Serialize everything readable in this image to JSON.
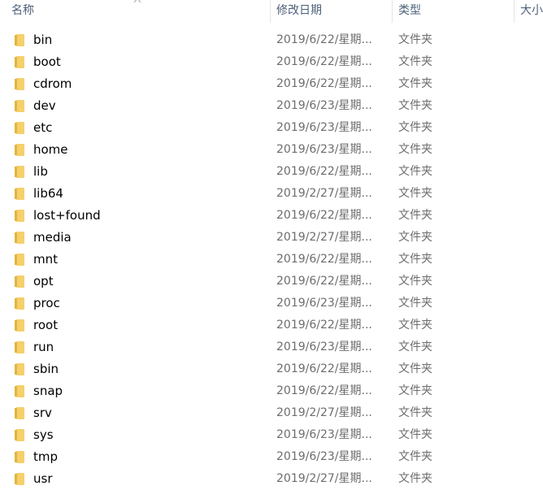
{
  "header": {
    "name_label": "名称",
    "date_label": "修改日期",
    "type_label": "类型",
    "size_label": "大小"
  },
  "rows": [
    {
      "name": "bin",
      "date": "2019/6/22/星期...",
      "type": "文件夹"
    },
    {
      "name": "boot",
      "date": "2019/6/22/星期...",
      "type": "文件夹"
    },
    {
      "name": "cdrom",
      "date": "2019/6/22/星期...",
      "type": "文件夹"
    },
    {
      "name": "dev",
      "date": "2019/6/23/星期...",
      "type": "文件夹"
    },
    {
      "name": "etc",
      "date": "2019/6/23/星期...",
      "type": "文件夹"
    },
    {
      "name": "home",
      "date": "2019/6/23/星期...",
      "type": "文件夹"
    },
    {
      "name": "lib",
      "date": "2019/6/22/星期...",
      "type": "文件夹"
    },
    {
      "name": "lib64",
      "date": "2019/2/27/星期...",
      "type": "文件夹"
    },
    {
      "name": "lost+found",
      "date": "2019/6/22/星期...",
      "type": "文件夹"
    },
    {
      "name": "media",
      "date": "2019/2/27/星期...",
      "type": "文件夹"
    },
    {
      "name": "mnt",
      "date": "2019/6/22/星期...",
      "type": "文件夹"
    },
    {
      "name": "opt",
      "date": "2019/6/22/星期...",
      "type": "文件夹"
    },
    {
      "name": "proc",
      "date": "2019/6/23/星期...",
      "type": "文件夹"
    },
    {
      "name": "root",
      "date": "2019/6/22/星期...",
      "type": "文件夹"
    },
    {
      "name": "run",
      "date": "2019/6/23/星期...",
      "type": "文件夹"
    },
    {
      "name": "sbin",
      "date": "2019/6/22/星期...",
      "type": "文件夹"
    },
    {
      "name": "snap",
      "date": "2019/6/22/星期...",
      "type": "文件夹"
    },
    {
      "name": "srv",
      "date": "2019/2/27/星期...",
      "type": "文件夹"
    },
    {
      "name": "sys",
      "date": "2019/6/23/星期...",
      "type": "文件夹"
    },
    {
      "name": "tmp",
      "date": "2019/6/23/星期...",
      "type": "文件夹"
    },
    {
      "name": "usr",
      "date": "2019/2/27/星期...",
      "type": "文件夹"
    }
  ],
  "icons": {
    "folder": "folder-icon",
    "sort": "sort-ascending-icon"
  },
  "colors": {
    "folder_fill": "#f5d06b",
    "folder_shade": "#e2b43c",
    "header_text": "#4c607a",
    "secondary_text": "#6d6d6d"
  }
}
